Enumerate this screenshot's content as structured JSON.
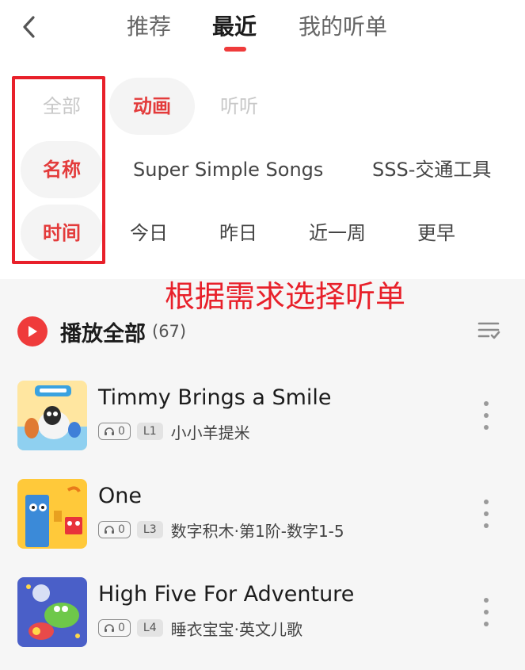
{
  "header": {
    "tabs": [
      {
        "label": "推荐"
      },
      {
        "label": "最近"
      },
      {
        "label": "我的听单"
      }
    ],
    "active_tab": "最近"
  },
  "filters": {
    "type_row": {
      "label": "全部",
      "options": [
        "动画",
        "听听"
      ],
      "selected": "动画"
    },
    "name_row": {
      "label": "名称",
      "options": [
        "Super Simple Songs",
        "SSS-交通工具"
      ]
    },
    "time_row": {
      "label": "时间",
      "options": [
        "今日",
        "昨日",
        "近一周",
        "更早"
      ]
    }
  },
  "annotation": "根据需求选择听单",
  "playall": {
    "label": "播放全部",
    "count": "(67)"
  },
  "tracks": [
    {
      "title": "Timmy Brings a Smile",
      "plays": "0",
      "level": "L1",
      "subtitle": "小小羊提米"
    },
    {
      "title": "One",
      "plays": "0",
      "level": "L3",
      "subtitle": "数字积木·第1阶-数字1-5"
    },
    {
      "title": "High Five For Adventure",
      "plays": "0",
      "level": "L4",
      "subtitle": "睡衣宝宝·英文儿歌"
    }
  ],
  "colors": {
    "accent": "#ef3b3b",
    "annotation": "#e8202a",
    "list_bg": "#f6f6f6"
  },
  "icons": [
    "back-chevron-icon",
    "play-icon",
    "playlist-sort-icon",
    "headphones-icon",
    "more-vertical-icon"
  ]
}
